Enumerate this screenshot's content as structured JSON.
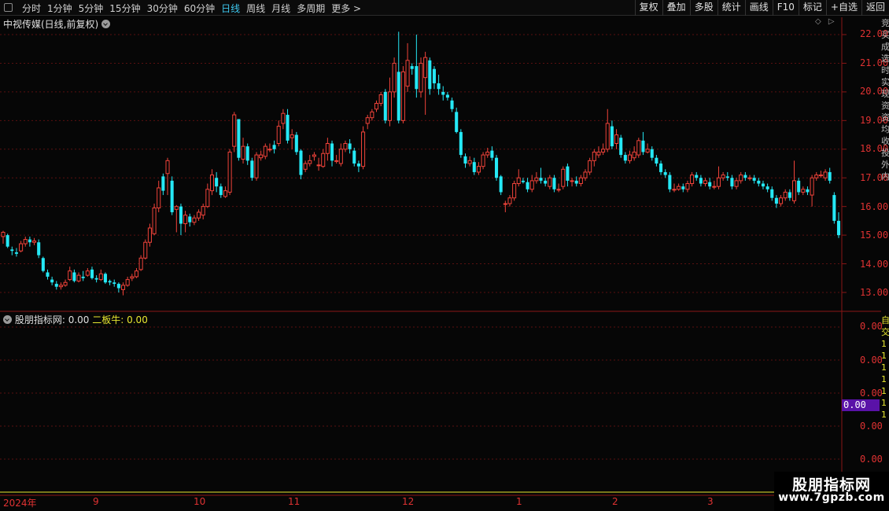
{
  "toolbar": {
    "period_tabs": [
      "分时",
      "1分钟",
      "5分钟",
      "15分钟",
      "30分钟",
      "60分钟",
      "日线",
      "周线",
      "月线",
      "多周期",
      "更多 >"
    ],
    "active_tab": 6,
    "right_buttons": [
      "复权",
      "叠加",
      "多股",
      "统计",
      "画线",
      "F10",
      "标记",
      "+自选",
      "返回"
    ]
  },
  "stock": {
    "title": "中视传媒(日线,前复权)"
  },
  "price_axis": {
    "ticks": [
      "22.00",
      "21.00",
      "20.00",
      "19.00",
      "18.00",
      "17.00",
      "16.00",
      "15.00",
      "14.00",
      "13.00"
    ]
  },
  "indicator": {
    "name": "股朋指标网",
    "value_text": ": 0.00",
    "series2_text": "二板牛: 0.00",
    "axis_ticks": [
      "0.00",
      "0.00",
      "0.00",
      "0.00",
      "0.00"
    ],
    "current_value": "0.00"
  },
  "date_axis": {
    "labels": [
      "2024年",
      "9",
      "10",
      "11",
      "12",
      "1",
      "2",
      "3"
    ]
  },
  "edge_text": {
    "top": "竞买成选时实现资资均收投外内",
    "bottom": "自交1111111"
  },
  "watermark": {
    "title": "股朋指标网",
    "url": "www.7gpzb.com"
  },
  "colors": {
    "up": "#f0433a",
    "down": "#25e8f5",
    "axis": "#e03232",
    "grid": "#5a1010",
    "active_tab": "#3ec9f0",
    "highlight": "#5a12a8"
  },
  "chart_data": {
    "type": "candlestick",
    "title": "中视传媒(日线,前复权)",
    "ylim": [
      12.6,
      22.4
    ],
    "x_labels": [
      "2024年",
      "9",
      "10",
      "11",
      "12",
      "1",
      "2",
      "3"
    ],
    "candles": [
      [
        14.95,
        15.1,
        14.7,
        15.15
      ],
      [
        15.0,
        14.6,
        14.55,
        15.05
      ],
      [
        14.5,
        14.45,
        14.3,
        14.6
      ],
      [
        14.4,
        14.35,
        14.25,
        14.55
      ],
      [
        14.45,
        14.7,
        14.4,
        14.8
      ],
      [
        14.7,
        14.85,
        14.6,
        14.95
      ],
      [
        14.85,
        14.75,
        14.6,
        14.95
      ],
      [
        14.75,
        14.8,
        14.65,
        14.9
      ],
      [
        14.75,
        14.3,
        14.2,
        14.85
      ],
      [
        14.2,
        13.75,
        13.7,
        14.25
      ],
      [
        13.7,
        13.55,
        13.45,
        13.8
      ],
      [
        13.45,
        13.35,
        13.25,
        13.55
      ],
      [
        13.3,
        13.2,
        13.1,
        13.4
      ],
      [
        13.2,
        13.25,
        13.1,
        13.35
      ],
      [
        13.25,
        13.35,
        13.2,
        13.45
      ],
      [
        13.45,
        13.75,
        13.4,
        13.9
      ],
      [
        13.7,
        13.4,
        13.35,
        13.8
      ],
      [
        13.4,
        13.6,
        13.35,
        13.7
      ],
      [
        13.55,
        13.5,
        13.4,
        13.75
      ],
      [
        13.6,
        13.75,
        13.55,
        13.85
      ],
      [
        13.8,
        13.5,
        13.45,
        13.9
      ],
      [
        13.5,
        13.45,
        13.35,
        13.6
      ],
      [
        13.45,
        13.65,
        13.4,
        13.8
      ],
      [
        13.65,
        13.35,
        13.3,
        13.7
      ],
      [
        13.4,
        13.35,
        13.25,
        13.45
      ],
      [
        13.35,
        13.3,
        13.2,
        13.45
      ],
      [
        13.3,
        13.15,
        13.0,
        13.35
      ],
      [
        13.1,
        13.25,
        12.9,
        13.35
      ],
      [
        13.25,
        13.45,
        13.2,
        13.55
      ],
      [
        13.5,
        13.55,
        13.4,
        13.65
      ],
      [
        13.55,
        13.75,
        13.5,
        13.85
      ],
      [
        13.8,
        14.2,
        13.75,
        14.3
      ],
      [
        14.2,
        14.75,
        14.15,
        14.85
      ],
      [
        14.75,
        15.25,
        14.6,
        15.4
      ],
      [
        15.05,
        15.95,
        15.0,
        16.1
      ],
      [
        15.95,
        16.65,
        15.8,
        16.9
      ],
      [
        17.05,
        16.55,
        16.4,
        17.15
      ],
      [
        17.15,
        17.6,
        16.4,
        17.7
      ],
      [
        16.9,
        15.8,
        15.7,
        17.05
      ],
      [
        15.9,
        16.0,
        15.1,
        16.05
      ],
      [
        16.0,
        15.4,
        15.0,
        16.1
      ],
      [
        15.4,
        15.7,
        15.1,
        15.85
      ],
      [
        15.65,
        15.45,
        15.3,
        15.75
      ],
      [
        15.45,
        15.6,
        15.35,
        15.7
      ],
      [
        15.6,
        15.8,
        15.5,
        15.9
      ],
      [
        15.7,
        16.0,
        15.55,
        16.1
      ],
      [
        16.0,
        16.6,
        15.95,
        16.8
      ],
      [
        16.55,
        17.1,
        16.4,
        17.3
      ],
      [
        17.0,
        16.7,
        16.5,
        17.2
      ],
      [
        16.7,
        16.4,
        16.3,
        16.8
      ],
      [
        16.35,
        16.55,
        16.3,
        16.7
      ],
      [
        16.5,
        17.9,
        16.4,
        18.0
      ],
      [
        18.1,
        19.2,
        17.9,
        19.3
      ],
      [
        19.05,
        17.7,
        17.6,
        19.05
      ],
      [
        17.65,
        18.1,
        17.5,
        18.4
      ],
      [
        18.1,
        17.6,
        17.45,
        18.2
      ],
      [
        17.6,
        17.0,
        16.9,
        17.7
      ],
      [
        17.0,
        17.8,
        16.9,
        17.9
      ],
      [
        17.7,
        17.8,
        17.6,
        17.95
      ],
      [
        17.75,
        18.1,
        17.65,
        18.2
      ],
      [
        18.0,
        18.0,
        17.9,
        18.2
      ],
      [
        18.15,
        18.0,
        17.85,
        18.3
      ],
      [
        18.2,
        18.8,
        18.1,
        19.0
      ],
      [
        18.9,
        19.25,
        18.7,
        19.4
      ],
      [
        19.2,
        18.3,
        18.2,
        19.4
      ],
      [
        18.4,
        18.5,
        18.0,
        18.7
      ],
      [
        18.5,
        17.9,
        17.8,
        18.6
      ],
      [
        17.95,
        17.1,
        16.95,
        18.0
      ],
      [
        17.3,
        17.5,
        17.2,
        17.6
      ],
      [
        17.5,
        17.6,
        17.4,
        17.8
      ],
      [
        17.75,
        17.8,
        17.6,
        17.9
      ],
      [
        17.45,
        17.45,
        17.25,
        17.7
      ],
      [
        17.4,
        17.85,
        17.35,
        18.0
      ],
      [
        17.85,
        18.2,
        17.6,
        18.4
      ],
      [
        18.2,
        17.6,
        17.4,
        18.3
      ],
      [
        17.6,
        17.6,
        17.5,
        17.8
      ],
      [
        17.5,
        18.0,
        17.4,
        18.2
      ],
      [
        18.0,
        18.2,
        17.9,
        18.3
      ],
      [
        18.2,
        18.0,
        17.85,
        18.35
      ],
      [
        17.95,
        17.5,
        17.4,
        18.05
      ],
      [
        17.5,
        17.4,
        17.2,
        17.6
      ],
      [
        17.4,
        18.6,
        17.3,
        18.8
      ],
      [
        18.9,
        19.1,
        18.7,
        19.2
      ],
      [
        19.1,
        19.3,
        19.0,
        19.4
      ],
      [
        19.4,
        19.6,
        19.3,
        19.7
      ],
      [
        19.6,
        19.9,
        19.5,
        20.0
      ],
      [
        20.0,
        19.0,
        18.9,
        20.1
      ],
      [
        19.0,
        20.0,
        18.8,
        20.5
      ],
      [
        20.0,
        21.0,
        19.8,
        21.2
      ],
      [
        20.7,
        19.0,
        18.9,
        22.1
      ],
      [
        19.0,
        20.7,
        18.9,
        20.9
      ],
      [
        20.2,
        21.1,
        20.0,
        21.7
      ],
      [
        20.9,
        20.8,
        20.6,
        21.0
      ],
      [
        20.9,
        20.1,
        19.8,
        22.0
      ],
      [
        20.0,
        21.0,
        19.8,
        21.2
      ],
      [
        20.5,
        21.2,
        19.2,
        21.4
      ],
      [
        21.1,
        20.1,
        19.9,
        21.2
      ],
      [
        20.8,
        20.3,
        20.1,
        20.9
      ],
      [
        20.3,
        20.1,
        19.9,
        20.6
      ],
      [
        20.0,
        19.9,
        19.7,
        20.2
      ],
      [
        19.9,
        19.8,
        19.7,
        20.0
      ],
      [
        19.7,
        19.4,
        19.3,
        19.8
      ],
      [
        19.3,
        18.6,
        18.55,
        19.45
      ],
      [
        18.6,
        17.8,
        17.7,
        18.7
      ],
      [
        17.75,
        17.5,
        17.35,
        17.85
      ],
      [
        17.5,
        17.6,
        17.4,
        17.75
      ],
      [
        17.55,
        17.2,
        17.1,
        17.7
      ],
      [
        17.2,
        17.4,
        17.1,
        17.55
      ],
      [
        17.4,
        17.8,
        17.3,
        17.9
      ],
      [
        17.8,
        17.9,
        17.7,
        18.05
      ],
      [
        17.95,
        17.7,
        17.6,
        18.1
      ],
      [
        17.7,
        17.0,
        16.9,
        17.8
      ],
      [
        17.05,
        16.5,
        16.4,
        17.1
      ],
      [
        16.1,
        16.1,
        15.8,
        16.2
      ],
      [
        16.1,
        16.3,
        16.0,
        16.4
      ],
      [
        16.3,
        16.8,
        16.2,
        16.9
      ],
      [
        16.8,
        17.0,
        16.7,
        17.3
      ],
      [
        16.9,
        16.85,
        16.8,
        17.0
      ],
      [
        16.85,
        16.6,
        16.5,
        17.0
      ],
      [
        16.6,
        16.9,
        16.5,
        17.1
      ],
      [
        16.9,
        17.0,
        16.8,
        17.2
      ],
      [
        17.0,
        16.9,
        16.8,
        17.35
      ],
      [
        16.9,
        16.8,
        16.7,
        17.0
      ],
      [
        16.7,
        17.0,
        16.6,
        17.1
      ],
      [
        17.0,
        16.6,
        16.5,
        17.1
      ],
      [
        16.6,
        16.6,
        16.5,
        16.8
      ],
      [
        16.7,
        17.3,
        16.6,
        17.4
      ],
      [
        17.4,
        16.9,
        16.7,
        17.5
      ],
      [
        16.9,
        16.9,
        16.7,
        17.0
      ],
      [
        16.9,
        16.8,
        16.7,
        17.05
      ],
      [
        16.8,
        17.0,
        16.7,
        17.1
      ],
      [
        17.0,
        17.2,
        16.9,
        17.3
      ],
      [
        17.2,
        17.6,
        17.1,
        17.7
      ],
      [
        17.6,
        17.9,
        17.4,
        18.0
      ],
      [
        17.8,
        17.9,
        17.7,
        18.1
      ],
      [
        17.9,
        18.0,
        17.8,
        18.2
      ],
      [
        18.0,
        18.9,
        17.9,
        19.4
      ],
      [
        18.8,
        18.1,
        18.0,
        19.0
      ],
      [
        18.2,
        18.5,
        18.0,
        18.7
      ],
      [
        18.4,
        17.8,
        17.7,
        18.5
      ],
      [
        17.8,
        17.6,
        17.5,
        17.9
      ],
      [
        17.6,
        17.8,
        17.5,
        17.95
      ],
      [
        17.7,
        17.9,
        17.6,
        18.1
      ],
      [
        17.8,
        18.3,
        17.7,
        18.4
      ],
      [
        18.3,
        17.9,
        17.8,
        18.6
      ],
      [
        17.9,
        18.0,
        17.85,
        18.2
      ],
      [
        18.0,
        17.7,
        17.6,
        18.1
      ],
      [
        17.7,
        17.5,
        17.4,
        17.8
      ],
      [
        17.5,
        17.2,
        17.1,
        17.6
      ],
      [
        17.2,
        17.1,
        17.0,
        17.3
      ],
      [
        17.1,
        16.6,
        16.5,
        17.2
      ],
      [
        16.6,
        16.6,
        16.5,
        16.8
      ],
      [
        16.6,
        16.7,
        16.55,
        16.8
      ],
      [
        16.7,
        16.6,
        16.5,
        16.8
      ],
      [
        16.6,
        16.8,
        16.5,
        16.9
      ],
      [
        16.8,
        17.1,
        16.7,
        17.2
      ],
      [
        17.1,
        17.0,
        16.9,
        17.2
      ],
      [
        17.0,
        16.8,
        16.7,
        17.1
      ],
      [
        16.8,
        16.9,
        16.7,
        17.0
      ],
      [
        16.85,
        16.7,
        16.6,
        17.0
      ],
      [
        16.7,
        16.7,
        16.6,
        16.9
      ],
      [
        16.7,
        17.0,
        16.6,
        17.4
      ],
      [
        17.0,
        17.1,
        16.9,
        17.2
      ],
      [
        17.05,
        17.0,
        16.9,
        17.2
      ],
      [
        17.0,
        16.7,
        16.6,
        17.1
      ],
      [
        16.7,
        16.9,
        16.6,
        17.0
      ],
      [
        16.9,
        17.1,
        16.8,
        17.2
      ],
      [
        17.1,
        17.0,
        16.9,
        17.2
      ],
      [
        17.0,
        17.0,
        16.9,
        17.1
      ],
      [
        17.0,
        16.9,
        16.8,
        17.1
      ],
      [
        16.9,
        16.8,
        16.7,
        17.0
      ],
      [
        16.8,
        16.7,
        16.6,
        16.9
      ],
      [
        16.7,
        16.6,
        16.5,
        16.8
      ],
      [
        16.6,
        16.3,
        16.2,
        16.7
      ],
      [
        16.3,
        16.1,
        15.95,
        16.4
      ],
      [
        16.1,
        16.3,
        16.0,
        16.4
      ],
      [
        16.3,
        16.5,
        16.2,
        16.6
      ],
      [
        16.5,
        16.3,
        16.2,
        16.6
      ],
      [
        16.2,
        16.9,
        16.1,
        17.6
      ],
      [
        16.9,
        16.5,
        16.4,
        17.0
      ],
      [
        16.5,
        16.6,
        16.4,
        16.7
      ],
      [
        16.6,
        16.5,
        16.4,
        16.7
      ],
      [
        16.4,
        17.0,
        16.0,
        17.1
      ],
      [
        17.0,
        17.1,
        16.9,
        17.2
      ],
      [
        17.1,
        17.1,
        17.0,
        17.25
      ],
      [
        17.0,
        17.2,
        16.9,
        17.3
      ],
      [
        17.2,
        16.9,
        16.8,
        17.35
      ],
      [
        16.4,
        15.5,
        15.4,
        16.5
      ],
      [
        15.5,
        15.0,
        14.9,
        15.8
      ]
    ]
  }
}
